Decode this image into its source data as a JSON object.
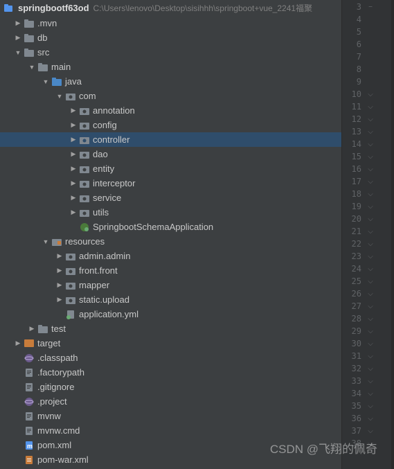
{
  "header": {
    "project_name": "springbootf63od",
    "project_path": "C:\\Users\\lenovo\\Desktop\\sisihhh\\springboot+vue_2241福聚"
  },
  "tree": {
    "mvn": ".mvn",
    "db": "db",
    "src": "src",
    "main": "main",
    "java": "java",
    "com": "com",
    "annotation": "annotation",
    "config": "config",
    "controller": "controller",
    "dao": "dao",
    "entity": "entity",
    "interceptor": "interceptor",
    "service": "service",
    "utils": "utils",
    "springboot_app": "SpringbootSchemaApplication",
    "resources": "resources",
    "admin": "admin.admin",
    "front": "front.front",
    "mapper": "mapper",
    "static_upload": "static.upload",
    "app_yml": "application.yml",
    "test": "test",
    "target": "target",
    "classpath": ".classpath",
    "factorypath": ".factorypath",
    "gitignore": ".gitignore",
    "project": ".project",
    "mvnw": "mvnw",
    "mvnw_cmd": "mvnw.cmd",
    "pom_xml": "pom.xml",
    "pom_war": "pom-war.xml"
  },
  "line_numbers": [
    "3",
    "4",
    "5",
    "6",
    "7",
    "8",
    "9",
    "10",
    "11",
    "12",
    "13",
    "14",
    "15",
    "16",
    "17",
    "18",
    "19",
    "20",
    "21",
    "22",
    "23",
    "24",
    "25",
    "26",
    "27",
    "28",
    "29",
    "30",
    "31",
    "32",
    "33",
    "34",
    "35",
    "36",
    "37",
    "38"
  ],
  "markers": {
    "l3": "−",
    "l10": "⌵",
    "l11": "⌵",
    "l12": "⌵",
    "l13": "⌵",
    "l14": "⌵",
    "l15": "⌵",
    "l16": "⌵",
    "l17": "⌵",
    "l18": "⌵",
    "l19": "⌵",
    "l20": "⌵",
    "l21": "⌵",
    "l22": "⌵",
    "l23": "⌵",
    "l24": "⌵",
    "l25": "⌵",
    "l26": "⌵",
    "l27": "⌵",
    "l28": "⌵",
    "l29": "⌵",
    "l30": "⌵",
    "l31": "⌵",
    "l32": "⌵",
    "l33": "⌵",
    "l34": "⌵",
    "l35": "⌵",
    "l36": "⌵",
    "l37": "⌵",
    "l38": "⌵"
  },
  "watermark": "CSDN @飞翔的佩奇"
}
